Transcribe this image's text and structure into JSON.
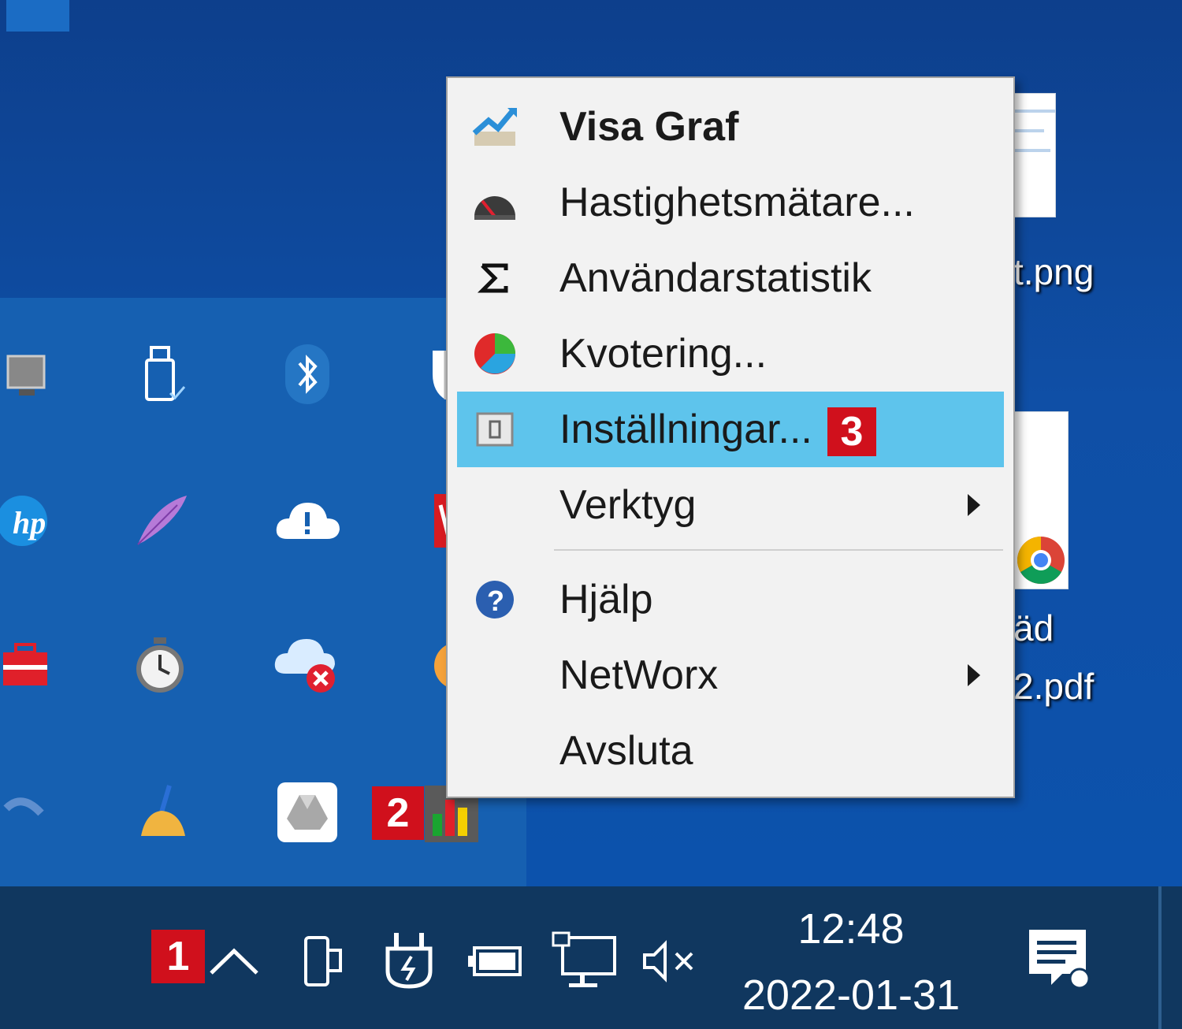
{
  "desktop": {
    "file1_label": "t.png",
    "file2_label_line1": "äd",
    "file2_label_line2": "2.pdf"
  },
  "tray": {
    "icons": [
      "monitor-icon",
      "usb-drive-icon",
      "bluetooth-icon",
      "shield-icon",
      "hp-icon",
      "feather-icon",
      "cloud-alert-icon",
      "pdf-icon",
      "toolbox-icon",
      "stopwatch-icon",
      "onedrive-error-icon",
      "orange-app-icon",
      "arc-icon",
      "broom-icon",
      "google-drive-icon",
      "networx-icon"
    ]
  },
  "badges": {
    "b1": "1",
    "b2": "2",
    "b3": "3"
  },
  "menu": {
    "items": [
      {
        "label": "Visa Graf",
        "icon": "graph-icon",
        "bold": true
      },
      {
        "label": "Hastighetsmätare...",
        "icon": "speedometer-icon"
      },
      {
        "label": "Användarstatistik",
        "icon": "sigma-icon"
      },
      {
        "label": "Kvotering...",
        "icon": "pie-chart-icon"
      },
      {
        "label": "Inställningar...",
        "icon": "settings-icon",
        "highlighted": true
      },
      {
        "label": "Verktyg",
        "submenu": true
      },
      {
        "label": "Hjälp",
        "icon": "help-icon"
      },
      {
        "label": "NetWorx",
        "submenu": true
      },
      {
        "label": "Avsluta"
      }
    ]
  },
  "taskbar": {
    "time": "12:48",
    "date": "2022-01-31",
    "icons": [
      "chevron-up-icon",
      "tablet-camera-icon",
      "power-plug-icon",
      "battery-icon",
      "network-icon",
      "volume-muted-icon",
      "notification-icon"
    ]
  },
  "colors": {
    "highlight": "#5ec4ec",
    "badge": "#d0101c",
    "taskbar": "#10375f",
    "tray": "#1660b1"
  }
}
